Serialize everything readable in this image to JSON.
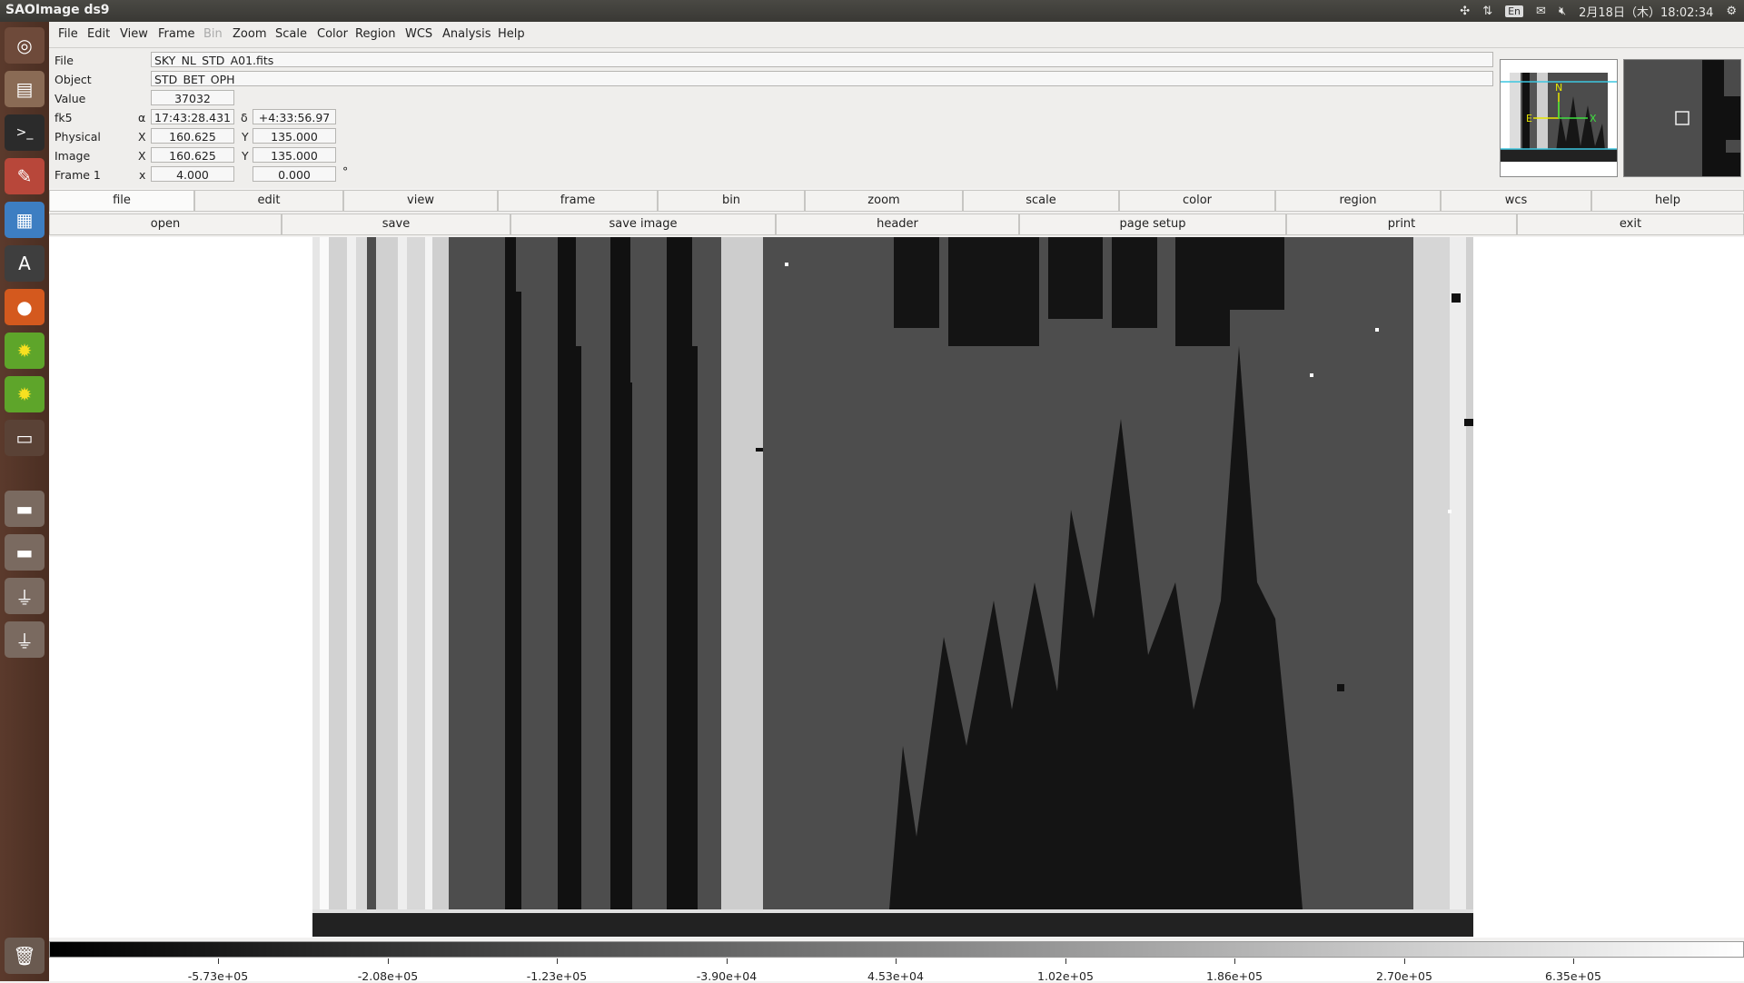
{
  "window": {
    "title": "SAOImage ds9"
  },
  "topbar": {
    "ime": "En",
    "datetime": "2月18日（木）18:02:34"
  },
  "launcher": {
    "icons": [
      "ubuntu-dash-icon",
      "files-icon",
      "terminal-icon",
      "settings-icon",
      "text-editor-icon",
      "software-center-icon",
      "firefox-icon",
      "ds9-icon",
      "ds9-icon-2",
      "archive-icon",
      "drive-icon",
      "drive-icon-2",
      "usb-drive-icon",
      "usb-drive-icon-2",
      "trash-icon"
    ]
  },
  "menu": [
    "File",
    "Edit",
    "View",
    "Frame",
    "Bin",
    "Zoom",
    "Scale",
    "Color",
    "Region",
    "WCS",
    "Analysis",
    "Help"
  ],
  "info": {
    "file_label": "File",
    "file_value": "SKY_NL_STD_A01.fits",
    "object_label": "Object",
    "object_value": "STD_BET_OPH",
    "value_label": "Value",
    "value_value": "37032",
    "fk5_label": "fk5",
    "alpha_symbol": "α",
    "alpha_value": "17:43:28.431",
    "delta_symbol": "δ",
    "delta_value": "+4:33:56.97",
    "physical_label": "Physical",
    "physical_x_label": "X",
    "physical_x": "160.625",
    "physical_y_label": "Y",
    "physical_y": "135.000",
    "image_label": "Image",
    "image_x_label": "X",
    "image_x": "160.625",
    "image_y_label": "Y",
    "image_y": "135.000",
    "frame_label": "Frame 1",
    "frame_x_label": "x",
    "frame_zoom": "4.000",
    "frame_angle": "0.000",
    "degree_symbol": "°"
  },
  "panner": {
    "north": "N",
    "east": "E",
    "x": "X"
  },
  "buttons_row1": [
    "file",
    "edit",
    "view",
    "frame",
    "bin",
    "zoom",
    "scale",
    "color",
    "region",
    "wcs",
    "help"
  ],
  "buttons_row2": [
    "open",
    "save",
    "save image",
    "header",
    "page setup",
    "print",
    "exit"
  ],
  "colorbar": {
    "ticks": [
      "-5.73e+05",
      "-2.08e+05",
      "-1.23e+05",
      "-3.90e+04",
      "4.53e+04",
      "1.02e+05",
      "1.86e+05",
      "2.70e+05",
      "6.35e+05"
    ]
  }
}
